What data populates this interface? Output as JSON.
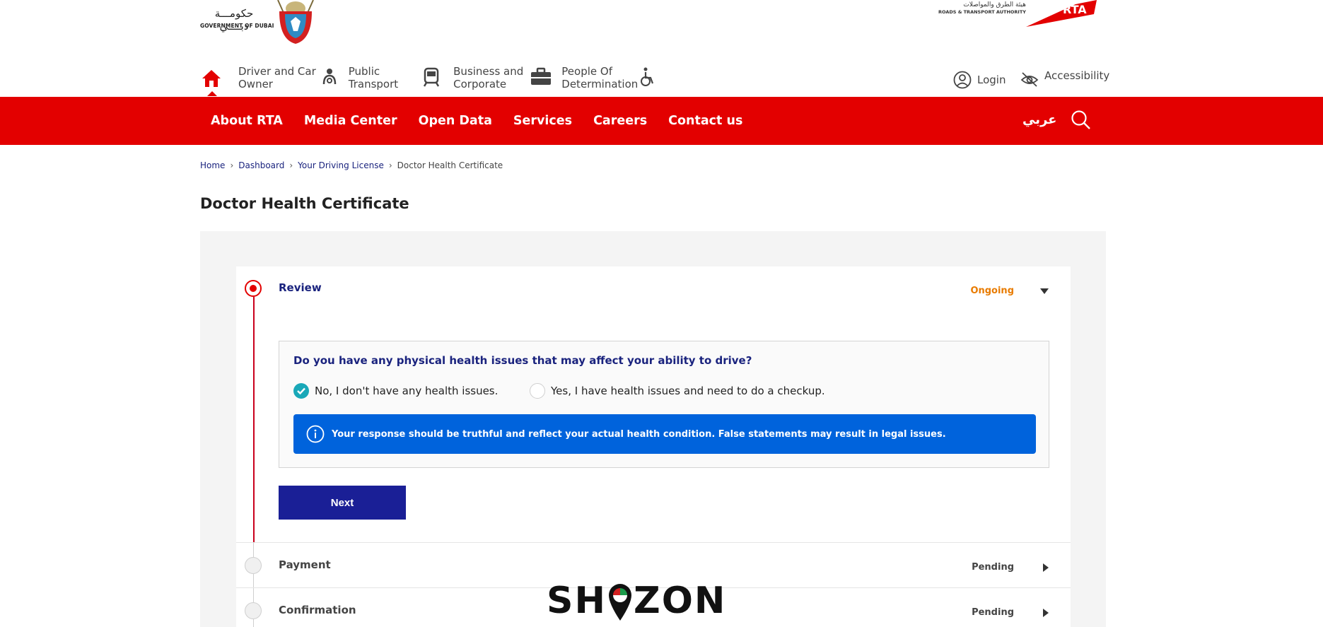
{
  "logos": {
    "gov_ar": "حكومـــة دبــــي",
    "gov_en": "GOVERNMENT OF DUBAI",
    "rta_ar": "هيئة الطرق والمواصلات",
    "rta_en": "ROADS & TRANSPORT AUTHORITY",
    "rta_mark": "RTA"
  },
  "top_nav": {
    "home_icon": "home-icon",
    "items": [
      {
        "label": "Driver and Car\nOwner",
        "icon": "driver-icon"
      },
      {
        "label": "Public\nTransport",
        "icon": "train-icon"
      },
      {
        "label": "Business and\nCorporate",
        "icon": "briefcase-icon"
      },
      {
        "label": "People Of\nDetermination",
        "icon": "wheelchair-icon"
      }
    ],
    "login": "Login",
    "accessibility": "Accessibility"
  },
  "main_menu": {
    "items": [
      "About RTA",
      "Media Center",
      "Open Data",
      "Services",
      "Careers",
      "Contact us"
    ],
    "arabic": "عربي"
  },
  "breadcrumb": {
    "items": [
      "Home",
      "Dashboard",
      "Your Driving License"
    ],
    "current": "Doctor Health Certificate"
  },
  "page": {
    "title": "Doctor Health Certificate"
  },
  "steps": {
    "review": {
      "name": "Review",
      "status": "Ongoing"
    },
    "payment": {
      "name": "Payment",
      "status": "Pending"
    },
    "confirmation": {
      "name": "Confirmation",
      "status": "Pending"
    }
  },
  "form": {
    "question": "Do you have any physical health issues that may affect your ability to drive?",
    "option_no": "No, I don't have any health issues.",
    "option_yes": "Yes, I have health issues and need to do a checkup.",
    "selected": "no",
    "notice": "Your response should be truthful and reflect your actual health condition. False statements may result in legal issues.",
    "next": "Next"
  },
  "watermark": {
    "text_left": "SH",
    "text_right": "ZON"
  },
  "colors": {
    "brand_red": "#e30000",
    "navy": "#1a237e",
    "button": "#1a1f96",
    "info_blue": "#0063dc",
    "ongoing": "#e87b00",
    "teal": "#19a8b8"
  }
}
